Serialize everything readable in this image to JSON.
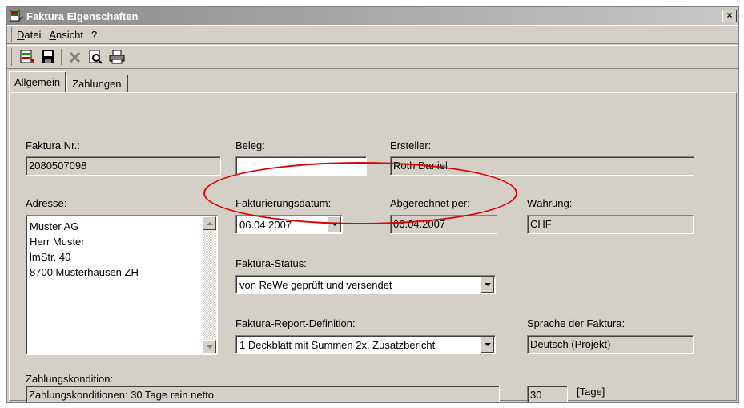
{
  "window": {
    "title": "Faktura Eigenschaften",
    "close_glyph": "×"
  },
  "menu": {
    "items": [
      {
        "accel": "D",
        "rest": "atei"
      },
      {
        "accel": "A",
        "rest": "nsicht"
      },
      {
        "accel": "",
        "rest": "?"
      }
    ]
  },
  "toolbar": {
    "icons": [
      "new-invoice-icon",
      "save-icon",
      "delete-icon",
      "print-preview-icon",
      "print-icon"
    ]
  },
  "tabs": [
    {
      "label": "Allgemein",
      "active": true
    },
    {
      "label": "Zahlungen",
      "active": false
    }
  ],
  "form": {
    "faktura_nr": {
      "label": "Faktura Nr.:",
      "value": "2080507098"
    },
    "beleg": {
      "label": "Beleg:",
      "value": ""
    },
    "ersteller": {
      "label": "Ersteller:",
      "value": "Roth Daniel"
    },
    "adresse": {
      "label": "Adresse:",
      "lines": [
        "Muster AG",
        "Herr Muster",
        "lmStr. 40",
        "8700 Musterhausen ZH"
      ]
    },
    "fakturierungsdatum": {
      "label": "Fakturierungsdatum:",
      "value": "06.04.2007"
    },
    "abgerechnet_per": {
      "label": "Abgerechnet per:",
      "value": "06.04.2007"
    },
    "waehrung": {
      "label": "Währung:",
      "value": "CHF"
    },
    "faktura_status": {
      "label": "Faktura-Status:",
      "value": "von ReWe geprüft und versendet"
    },
    "report_definition": {
      "label": "Faktura-Report-Definition:",
      "value": "1 Deckblatt mit Summen 2x, Zusatzbericht"
    },
    "sprache": {
      "label": "Sprache der Faktura:",
      "value": "Deutsch (Projekt)"
    },
    "zahlungskondition": {
      "label": "Zahlungskondition:",
      "value": "Zahlungskonditionen: 30 Tage rein netto"
    },
    "tage": {
      "value": "30",
      "unit": "[Tage]"
    }
  },
  "colors": {
    "highlight": "#e00000",
    "face": "#d4d0c8"
  }
}
